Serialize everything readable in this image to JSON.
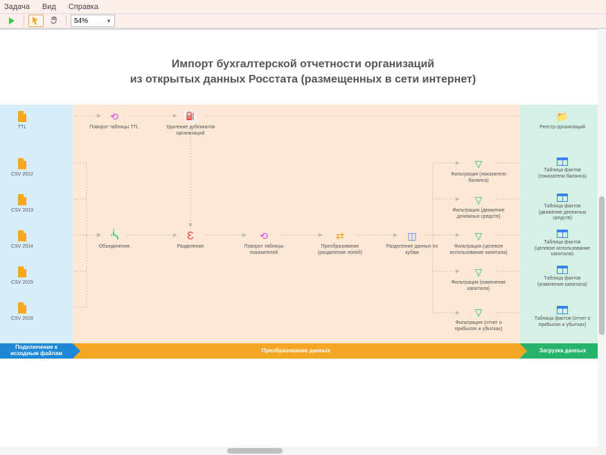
{
  "menubar": {
    "task": "Задача",
    "view": "Вид",
    "help": "Справка"
  },
  "toolbar": {
    "zoom": "54%"
  },
  "title": {
    "line1": "Импорт бухгалтерской отчетности организаций",
    "line2": "из открытых данных Росстата (размещенных в сети интернет)"
  },
  "source_files": {
    "ttl": "TTL",
    "csv2012": "CSV 2012",
    "csv2013": "CSV 2013",
    "csv2014": "CSV 2014",
    "csv2015": "CSV 2015",
    "csv2016": "CSV 2016"
  },
  "transform_nodes": {
    "rotate_ttl": "Поворот таблицы TTL",
    "dedup": "Удаление дубликатов организаций",
    "merge": "Объединение",
    "split": "Разделение",
    "rotate_ind": "Поворот таблицы показателей",
    "transform_fields": "Преобразование (разделение полей)",
    "cube_split": "Разделение данных по кубам",
    "filter_balance": "Фильтрация (показатели баланса)",
    "filter_cash": "Фильтрация (движение денежных средств)",
    "filter_capital": "Фильтрация (целевое использование капитала)",
    "filter_chg": "Фильтрация (изменение капитала)",
    "filter_pl": "Фильтрация (отчет о прибылях и убытках)"
  },
  "load_nodes": {
    "registry": "Реестр организаций",
    "fact_balance": "Таблица фактов (показатели баланса)",
    "fact_cash": "Таблица фактов (движение денежных средств)",
    "fact_capital": "Таблица фактов (целевое использование капитала)",
    "fact_chg": "Таблица фактов (изменение капитала)",
    "fact_pl": "Таблица фактов (отчет о прибылях и убытках)"
  },
  "footer": {
    "source": "Подключение к исходным файлам",
    "transform": "Преобразование данных",
    "load": "Загрузка данных"
  }
}
